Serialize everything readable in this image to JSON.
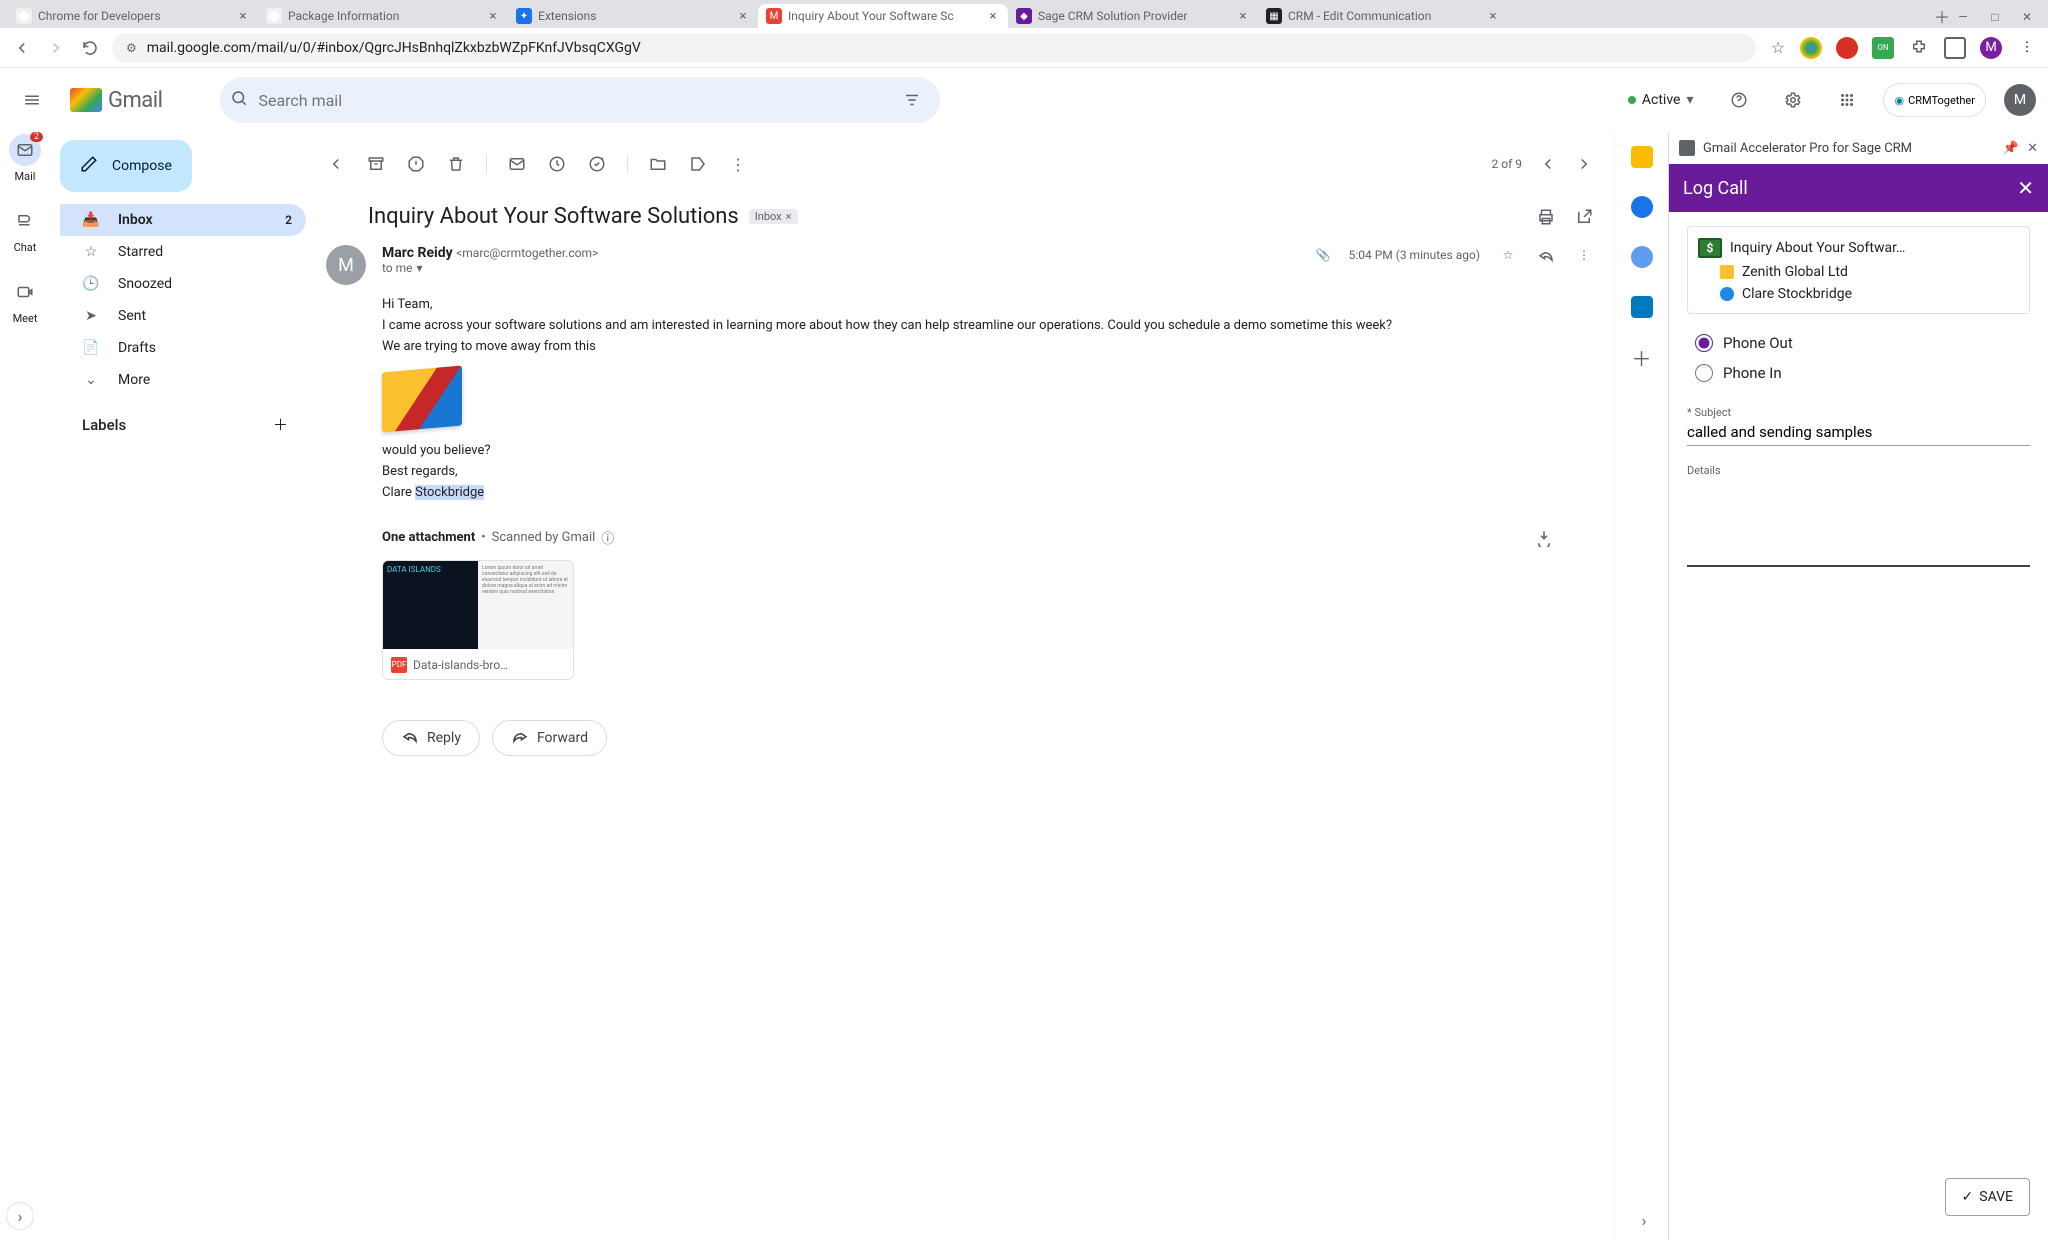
{
  "browser": {
    "tabs": [
      {
        "title": "Chrome for Developers",
        "favicon_bg": "#f1f1f1",
        "favicon_txt": "⬤"
      },
      {
        "title": "Package Information",
        "favicon_bg": "#f1f1f1",
        "favicon_txt": "⬤"
      },
      {
        "title": "Extensions",
        "favicon_bg": "#1a73e8",
        "favicon_txt": "✦"
      },
      {
        "title": "Inquiry About Your Software Sc",
        "favicon_bg": "#ea4335",
        "favicon_txt": "M",
        "active": true
      },
      {
        "title": "Sage CRM Solution Provider",
        "favicon_bg": "#6a1b9a",
        "favicon_txt": "◆"
      },
      {
        "title": "CRM - Edit Communication",
        "favicon_bg": "#202124",
        "favicon_txt": "▦"
      }
    ],
    "url": "mail.google.com/mail/u/0/#inbox/QgrcJHsBnhqlZkxbzbWZpFKnfJVbsqCXGgV"
  },
  "gmail": {
    "logo_text": "Gmail",
    "search_placeholder": "Search mail",
    "status": "Active",
    "crm_chip": "CRMTogether",
    "avatar": "M",
    "rail": [
      {
        "label": "Mail",
        "badge": "2"
      },
      {
        "label": "Chat"
      },
      {
        "label": "Meet"
      }
    ],
    "compose": "Compose",
    "nav": [
      {
        "label": "Inbox",
        "count": "2",
        "active": true
      },
      {
        "label": "Starred"
      },
      {
        "label": "Snoozed"
      },
      {
        "label": "Sent"
      },
      {
        "label": "Drafts"
      },
      {
        "label": "More"
      }
    ],
    "labels_header": "Labels",
    "toolbar_count": "2 of 9",
    "subject": "Inquiry About Your Software Solutions",
    "subject_pill": "Inbox",
    "sender": {
      "avatar": "M",
      "name": "Marc Reidy",
      "email": "<marc@crmtogether.com>",
      "to": "to me",
      "time": "5:04 PM (3 minutes ago)"
    },
    "body": {
      "l1": "Hi Team,",
      "l2": "I came across your software solutions and am interested in learning more about how they can help streamline our operations. Could you schedule a demo sometime this week?",
      "l3": "We are trying to move away from this",
      "l4": "would you believe?",
      "l5": "Best regards,",
      "l6a": "Clare ",
      "l6b": "Stockbridge"
    },
    "attachment": {
      "header_bold": "One attachment",
      "header_sep": "•",
      "header_scan": "Scanned by Gmail",
      "filename": "Data-islands-bro…",
      "preview_title": "DATA ISLANDS"
    },
    "reply": "Reply",
    "forward": "Forward"
  },
  "sidepanel": {
    "title": "Gmail Accelerator Pro for Sage CRM",
    "header": "Log Call",
    "entity": {
      "subject": "Inquiry About Your Softwar…",
      "company": "Zenith Global Ltd",
      "person": "Clare Stockbridge"
    },
    "radios": {
      "out": "Phone Out",
      "in": "Phone In",
      "selected": "out"
    },
    "subject_label": "Subject",
    "subject_value": "called and sending samples",
    "details_label": "Details",
    "details_value": "",
    "save": "SAVE"
  }
}
